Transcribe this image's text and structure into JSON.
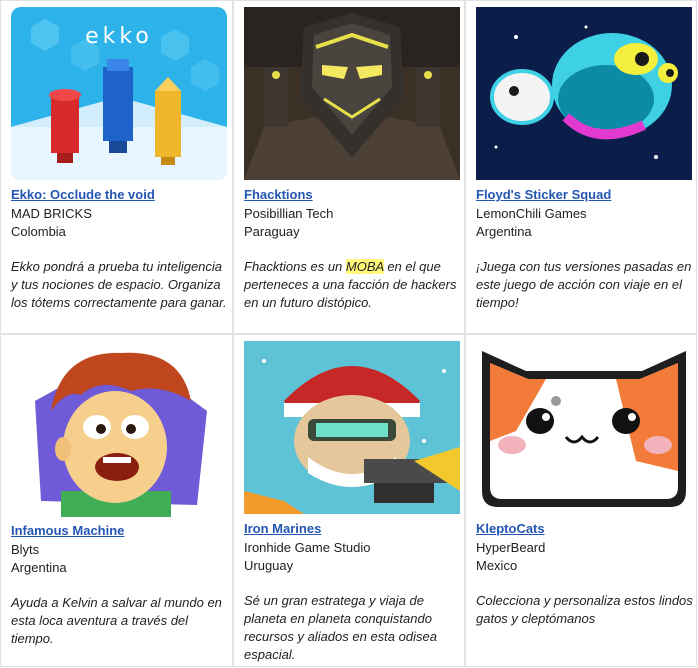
{
  "games": [
    {
      "title": "Ekko: Occlude the void",
      "developer": "MAD BRICKS",
      "country": "Colombia",
      "description": "Ekko pondrá a prueba tu inteligencia y tus nociones de espacio. Organiza los tótems correctamente para ganar.",
      "logo_text": "ekko"
    },
    {
      "title": "Fhacktions",
      "developer": "Posibillian Tech",
      "country": "Paraguay",
      "description_before": "Fhacktions es un ",
      "description_highlight": "MOBA",
      "description_after": " en el que perteneces a una facción de hackers en un futuro distópico."
    },
    {
      "title": "Floyd's Sticker Squad",
      "developer": "LemonChili Games",
      "country": "Argentina",
      "description": "¡Juega con tus versiones pasadas en este juego de acción con viaje en el tiempo!"
    },
    {
      "title": "Infamous Machine",
      "developer": "Blyts",
      "country": "Argentina",
      "description": "Ayuda a Kelvin a salvar al mundo en esta loca aventura a través del tiempo."
    },
    {
      "title": "Iron Marines",
      "developer": "Ironhide Game Studio",
      "country": "Uruguay",
      "description": "Sé un gran estratega y viaja de planeta en planeta conquistando recursos y aliados en esta odisea espacial."
    },
    {
      "title": "KleptoCats",
      "developer": "HyperBeard",
      "country": "Mexico",
      "description": "Colecciona y personaliza estos lindos gatos y cleptómanos"
    }
  ],
  "colors": {
    "link": "#2456b3",
    "highlight": "#fff87a",
    "border": "#e2e2e2"
  }
}
